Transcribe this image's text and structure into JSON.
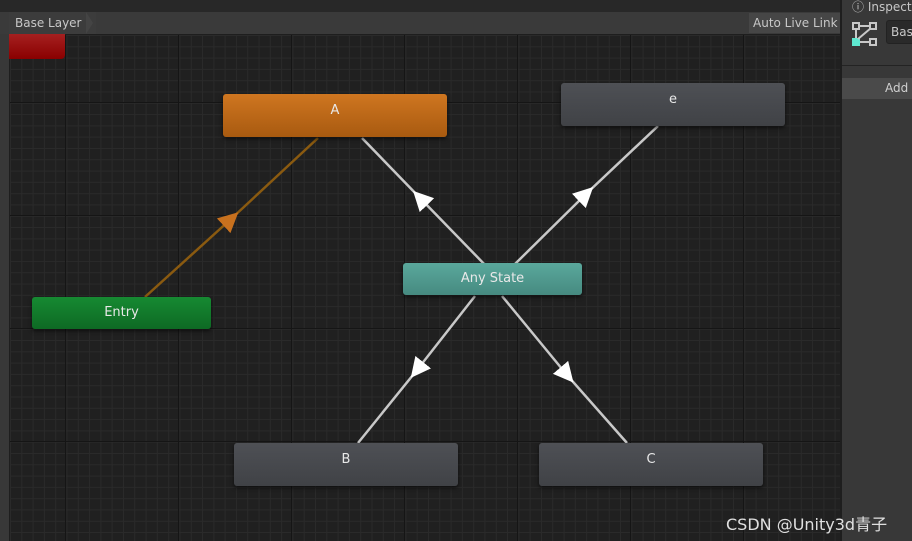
{
  "breadcrumb": {
    "layer": "Base Layer"
  },
  "toolbar": {
    "auto_live_link": "Auto Live Link"
  },
  "inspector": {
    "title": "Inspector",
    "layer_field": "Base",
    "add_button": "Add Behaviour",
    "accent": "#5ee8d0"
  },
  "states": {
    "a": "A",
    "e": "e",
    "any": "Any State",
    "entry": "Entry",
    "b": "B",
    "c": "C"
  },
  "colors": {
    "default_state": "#c8711e",
    "entry": "#127a2c",
    "any_state": "#4e9a8e",
    "exit": "#9a0a0a",
    "state": "#46484c"
  },
  "watermark": "CSDN @Unity3d青子"
}
